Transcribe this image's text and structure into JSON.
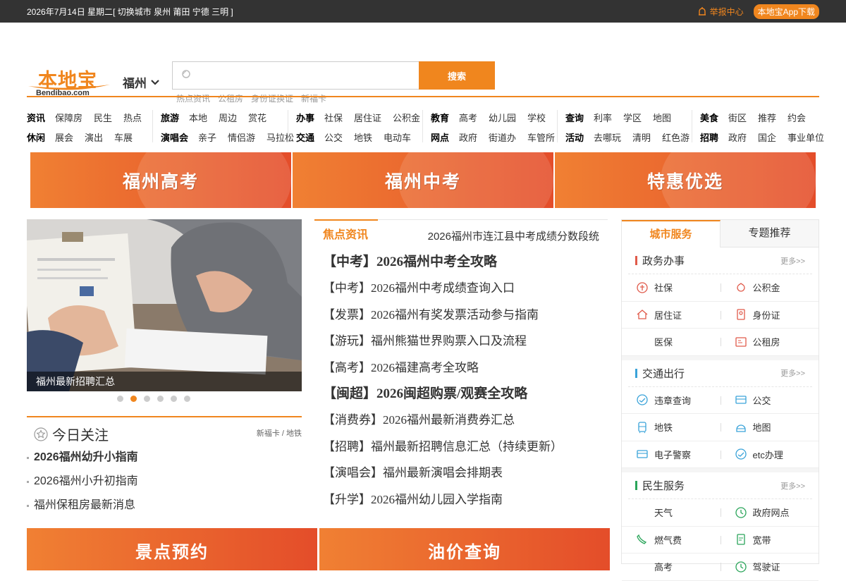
{
  "topbar": {
    "date": "2026年7月14日 星期二",
    "switch_city": "[ 切换城市 泉州 莆田 宁德 三明 ]",
    "report": "举报中心",
    "app": "本地宝App下载"
  },
  "logo": {
    "cn": "本地宝",
    "en": "Bendibao.com"
  },
  "city": "福州",
  "search": {
    "placeholder": "",
    "button": "搜索",
    "hotwords": [
      "热点资讯",
      "公租房",
      "身份证换证",
      "新福卡"
    ]
  },
  "nav": [
    {
      "rows": [
        {
          "head": "资讯",
          "items": [
            "保障房",
            "民生",
            "热点"
          ]
        },
        {
          "head": "休闲",
          "items": [
            "展会",
            "演出",
            "车展"
          ]
        }
      ]
    },
    {
      "rows": [
        {
          "head": "旅游",
          "items": [
            "本地",
            "周边",
            "赏花"
          ]
        },
        {
          "head": "演唱会",
          "items": [
            "亲子",
            "情侣游",
            "马拉松"
          ]
        }
      ]
    },
    {
      "rows": [
        {
          "head": "办事",
          "items": [
            "社保",
            "居住证",
            "公积金"
          ]
        },
        {
          "head": "交通",
          "items": [
            "公交",
            "地铁",
            "电动车"
          ]
        }
      ]
    },
    {
      "rows": [
        {
          "head": "教育",
          "items": [
            "高考",
            "幼儿园",
            "学校"
          ]
        },
        {
          "head": "网点",
          "items": [
            "政府",
            "街道办",
            "车管所"
          ]
        }
      ]
    },
    {
      "rows": [
        {
          "head": "查询",
          "items": [
            "利率",
            "学区",
            "地图"
          ]
        },
        {
          "head": "活动",
          "items": [
            "去哪玩",
            "清明",
            "红色游"
          ]
        }
      ]
    },
    {
      "rows": [
        {
          "head": "美食",
          "items": [
            "街区",
            "推荐",
            "约会"
          ]
        },
        {
          "head": "招聘",
          "items": [
            "政府",
            "国企",
            "事业单位"
          ]
        }
      ]
    }
  ],
  "banners": [
    "福州高考",
    "福州中考",
    "特惠优选"
  ],
  "slider": {
    "caption": "福州最新招聘汇总",
    "active_index": 1,
    "count": 6
  },
  "today": {
    "title": "今日关注",
    "more": "新福卡 / 地铁",
    "items": [
      "2026福州幼升小指南",
      "2026福州小升初指南",
      "福州保租房最新消息"
    ]
  },
  "focus": {
    "tab": "焦点资讯",
    "headline": "2026福州市连江县中考成绩分数段统",
    "items": [
      "【中考】2026福州中考全攻略",
      "【中考】2026福州中考成绩查询入口",
      "【发票】2026福州有奖发票活动参与指南",
      "【游玩】福州熊猫世界购票入口及流程",
      "【高考】2026福建高考全攻略",
      "【闽超】2026闽超购票/观赛全攻略",
      "【消费券】2026福州最新消费券汇总",
      "【招聘】福州最新招聘信息汇总（持续更新）",
      "【演唱会】福州最新演唱会排期表",
      "【升学】2026福州幼儿园入学指南"
    ]
  },
  "side": {
    "tab1": "城市服务",
    "tab2": "专题推荐",
    "more": "更多>>",
    "sections": [
      {
        "title": "政务办事",
        "color": "#e05a4a",
        "items": [
          [
            "社保",
            "公积金"
          ],
          [
            "居住证",
            "身份证"
          ],
          [
            "医保",
            "公租房"
          ]
        ]
      },
      {
        "title": "交通出行",
        "color": "#3aa3d9",
        "items": [
          [
            "违章查询",
            "公交"
          ],
          [
            "地铁",
            "地图"
          ],
          [
            "电子警察",
            "etc办理"
          ]
        ]
      },
      {
        "title": "民生服务",
        "color": "#2aa55a",
        "items": [
          [
            "天气",
            "政府网点"
          ],
          [
            "燃气费",
            "宽带"
          ],
          [
            "高考",
            "驾驶证"
          ]
        ]
      }
    ]
  },
  "bottom_banners": [
    "景点预约",
    "油价查询"
  ],
  "colors": {
    "accent": "#f0861e",
    "banner_gradient": [
      "#f08033",
      "#e44d2a"
    ]
  }
}
